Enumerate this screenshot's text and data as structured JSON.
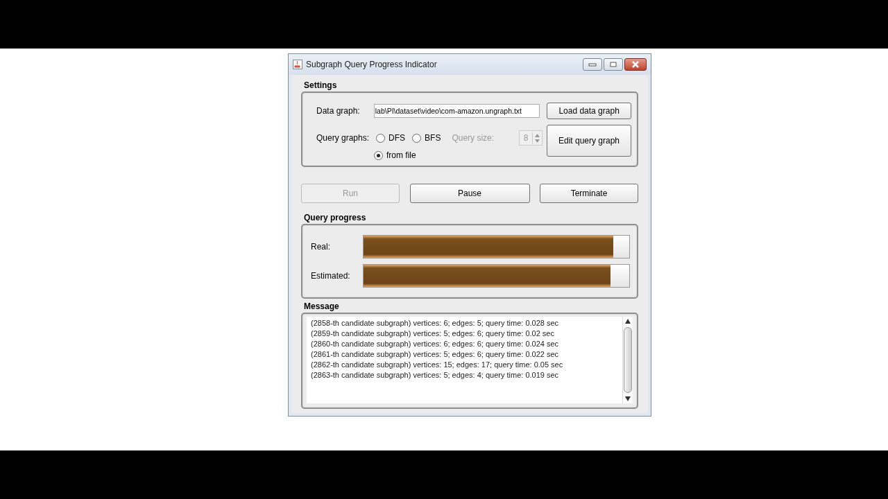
{
  "window": {
    "title": "Subgraph Query Progress Indicator"
  },
  "settings": {
    "title": "Settings",
    "data_graph_label": "Data graph:",
    "data_graph_value": "lab\\PI\\dataset\\video\\com-amazon.ungraph.txt",
    "load_button": "Load data graph",
    "query_graphs_label": "Query graphs:",
    "options": [
      {
        "label": "DFS",
        "selected": false
      },
      {
        "label": "BFS",
        "selected": false
      },
      {
        "label": "from file",
        "selected": true
      }
    ],
    "query_size_label": "Query size:",
    "query_size_value": "8",
    "query_size_disabled": true,
    "edit_button": "Edit query graph"
  },
  "actions": [
    {
      "label": "Run",
      "disabled": true
    },
    {
      "label": "Pause",
      "disabled": false
    },
    {
      "label": "Terminate",
      "disabled": false
    }
  ],
  "progress": {
    "title": "Query progress",
    "bars": [
      {
        "label": "Real:",
        "level": 0.94
      },
      {
        "label": "Estimated:",
        "level": 0.93
      }
    ]
  },
  "message": {
    "title": "Message",
    "lines": [
      "(2858-th candidate subgraph) vertices: 6; edges: 5; query time: 0.028 sec",
      "(2859-th candidate subgraph) vertices: 5; edges: 6; query time: 0.02 sec",
      "(2860-th candidate subgraph) vertices: 6; edges: 6; query time: 0.024 sec",
      "(2861-th candidate subgraph) vertices: 5; edges: 6; query time: 0.022 sec",
      "(2862-th candidate subgraph) vertices: 15; edges: 17; query time: 0.05 sec",
      "(2863-th candidate subgraph) vertices: 5; edges: 4; query time: 0.019 sec"
    ]
  }
}
